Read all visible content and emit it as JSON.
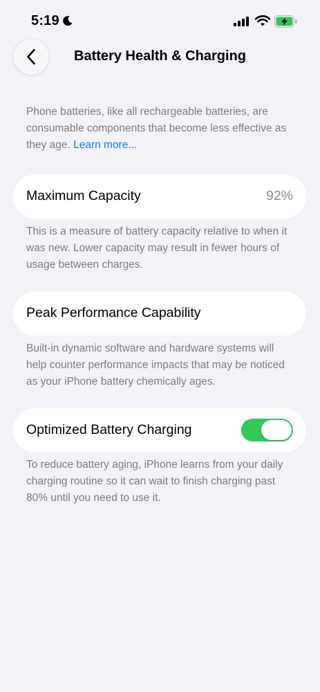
{
  "status": {
    "time": "5:19"
  },
  "header": {
    "title": "Battery Health & Charging"
  },
  "intro": {
    "text": "Phone batteries, like all rechargeable batteries, are consumable components that become less effective as they age. ",
    "link": "Learn more..."
  },
  "max_capacity": {
    "label": "Maximum Capacity",
    "value": "92%",
    "description": "This is a measure of battery capacity relative to when it was new. Lower capacity may result in fewer hours of usage between charges."
  },
  "peak_performance": {
    "label": "Peak Performance Capability",
    "description": "Built-in dynamic software and hardware systems will help counter performance impacts that may be noticed as your iPhone battery chemically ages."
  },
  "optimized_charging": {
    "label": "Optimized Battery Charging",
    "enabled": true,
    "description": "To reduce battery aging, iPhone learns from your daily charging routine so it can wait to finish charging past 80% until you need to use it."
  },
  "colors": {
    "accent": "#0a7aff",
    "toggle_on": "#34c759",
    "background": "#f2f2f7"
  }
}
